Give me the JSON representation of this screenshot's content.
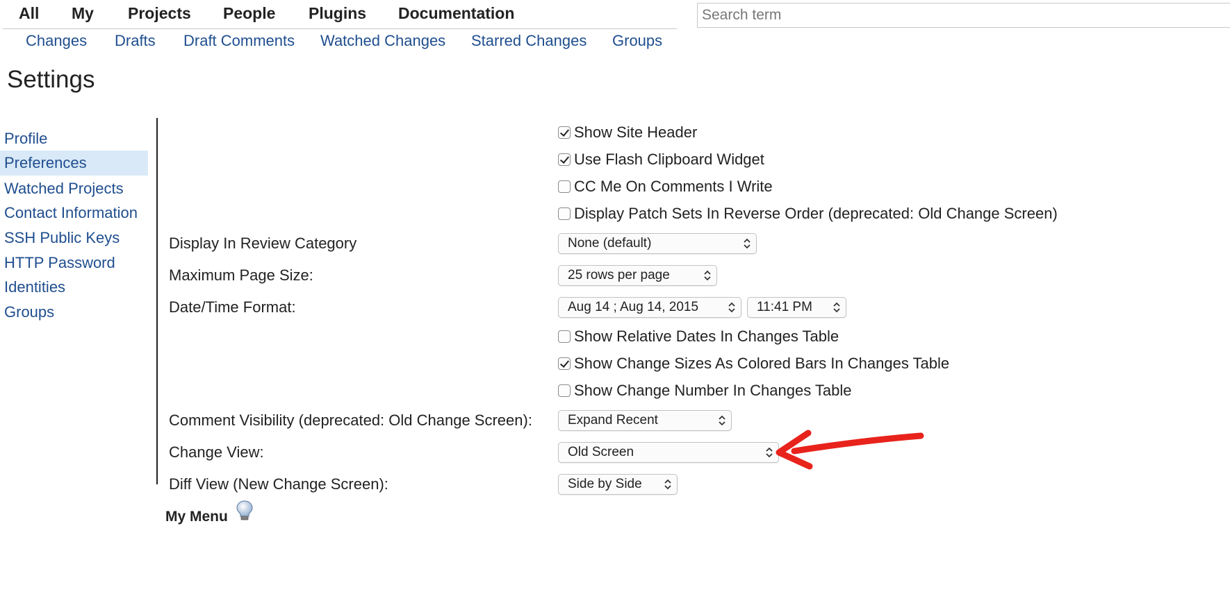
{
  "top_menu": {
    "items": [
      "All",
      "My",
      "Projects",
      "People",
      "Plugins",
      "Documentation"
    ]
  },
  "sub_menu": {
    "items": [
      "Changes",
      "Drafts",
      "Draft Comments",
      "Watched Changes",
      "Starred Changes",
      "Groups"
    ]
  },
  "search": {
    "placeholder": "Search term"
  },
  "page_title": "Settings",
  "sidebar": {
    "items": [
      "Profile",
      "Preferences",
      "Watched Projects",
      "Contact Information",
      "SSH Public Keys",
      "HTTP Password",
      "Identities",
      "Groups"
    ],
    "active": "Preferences"
  },
  "preferences": {
    "checkboxes_top": [
      {
        "label": "Show Site Header",
        "checked": true
      },
      {
        "label": "Use Flash Clipboard Widget",
        "checked": true
      },
      {
        "label": "CC Me On Comments I Write",
        "checked": false
      },
      {
        "label": "Display Patch Sets In Reverse Order (deprecated: Old Change Screen)",
        "checked": false
      }
    ],
    "review_category": {
      "label": "Display In Review Category",
      "value": "None (default)"
    },
    "page_size": {
      "label": "Maximum Page Size:",
      "value": "25 rows per page"
    },
    "date_time": {
      "label": "Date/Time Format:",
      "date_value": "Aug 14 ; Aug 14, 2015",
      "time_value": "11:41 PM"
    },
    "checkboxes_mid": [
      {
        "label": "Show Relative Dates In Changes Table",
        "checked": false
      },
      {
        "label": "Show Change Sizes As Colored Bars In Changes Table",
        "checked": true
      },
      {
        "label": "Show Change Number In Changes Table",
        "checked": false
      }
    ],
    "comment_visibility": {
      "label": "Comment Visibility (deprecated: Old Change Screen):",
      "value": "Expand Recent"
    },
    "change_view": {
      "label": "Change View:",
      "value": "Old Screen"
    },
    "diff_view": {
      "label": "Diff View (New Change Screen):",
      "value": "Side by Side"
    }
  },
  "my_menu": {
    "title": "My Menu"
  },
  "colors": {
    "link": "#1f4e8f",
    "active_bg": "#d9e9f7",
    "annotation_arrow": "#e8231c"
  },
  "icons": {
    "help": "lightbulb-icon",
    "select": "chevron-updown-icon",
    "checkbox": "checkmark-icon"
  }
}
